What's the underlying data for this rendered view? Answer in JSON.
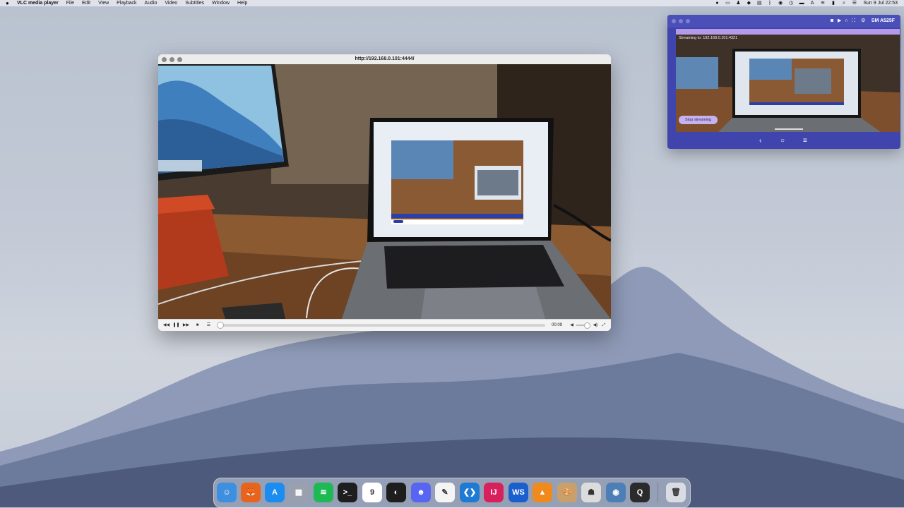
{
  "menubar": {
    "app_name": "VLC media player",
    "menus": [
      "File",
      "Edit",
      "View",
      "Playback",
      "Audio",
      "Video",
      "Subtitles",
      "Window",
      "Help"
    ],
    "clock": "Sun 9 Jul  22:53"
  },
  "vlc_window": {
    "title": "http://192.168.0.101:4444/",
    "time": "00:09",
    "controls": {
      "rewind": "◀◀",
      "pause": "❚❚",
      "forward": "▶▶",
      "stop": "■",
      "playlist": "☰",
      "volume_low": "◀",
      "volume_high": "◀)",
      "fullscreen": "⤢"
    },
    "seek_fraction": 0.0,
    "volume_fraction": 0.75
  },
  "phone_window": {
    "device_name": "SM A525F",
    "streaming_text": "Streaming to: 192.168.0.101:4321",
    "stop_label": "Stop streaming",
    "nav": {
      "back": "‹",
      "home": "○",
      "recents": "≡"
    }
  },
  "dock": {
    "apps": [
      {
        "name": "finder",
        "glyph": "☺",
        "color": "#3f8fe0"
      },
      {
        "name": "firefox",
        "glyph": "🦊",
        "color": "#e8641c"
      },
      {
        "name": "app-store",
        "glyph": "A",
        "color": "#1b8cf0"
      },
      {
        "name": "launchpad",
        "glyph": "▦",
        "color": "#9aa0ad"
      },
      {
        "name": "spotify",
        "glyph": "≋",
        "color": "#1db954"
      },
      {
        "name": "terminal",
        "glyph": ">_",
        "color": "#1e1e1e"
      },
      {
        "name": "calendar",
        "glyph": "9",
        "color": "#ffffff"
      },
      {
        "name": "figma",
        "glyph": "◐",
        "color": "#1e1e1e"
      },
      {
        "name": "discord",
        "glyph": "☻",
        "color": "#5865f2"
      },
      {
        "name": "textedit",
        "glyph": "✎",
        "color": "#f4f4f4"
      },
      {
        "name": "vscode",
        "glyph": "❮❯",
        "color": "#1f7ad4"
      },
      {
        "name": "intellij",
        "glyph": "IJ",
        "color": "#d8205c"
      },
      {
        "name": "webstorm",
        "glyph": "WS",
        "color": "#1b5fcf"
      },
      {
        "name": "vlc",
        "glyph": "▲",
        "color": "#f08a1c"
      },
      {
        "name": "paint",
        "glyph": "🎨",
        "color": "#c9a06b"
      },
      {
        "name": "mastodon",
        "glyph": "☗",
        "color": "#dcdcdc"
      },
      {
        "name": "preview",
        "glyph": "◉",
        "color": "#4c7fb5"
      },
      {
        "name": "quicktime",
        "glyph": "Q",
        "color": "#2b2b2b"
      },
      {
        "name": "trash",
        "glyph": "🗑",
        "color": "#d9dde3"
      }
    ]
  }
}
